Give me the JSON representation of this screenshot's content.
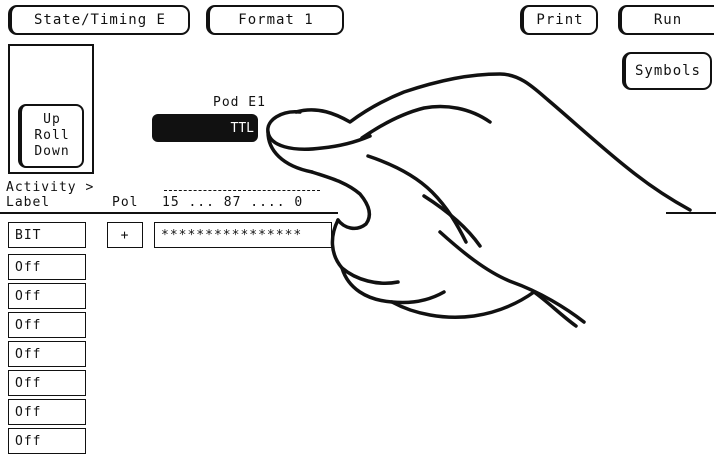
{
  "header": {
    "mode_button": "State/Timing E",
    "format_button": "Format 1",
    "print_button": "Print",
    "run_button": "Run",
    "symbols_button": "Symbols"
  },
  "roll": {
    "up": "Up",
    "roll": "Roll",
    "down": "Down"
  },
  "pod": {
    "title": "Pod E1",
    "threshold": "TTL"
  },
  "columns": {
    "activity": "Activity >",
    "label": "Label",
    "pol": "Pol",
    "bits": "15 ... 87 .... 0"
  },
  "rows": [
    {
      "label": "BIT",
      "pol": "+",
      "assignment": "****************"
    },
    {
      "label": "Off"
    },
    {
      "label": "Off"
    },
    {
      "label": "Off"
    },
    {
      "label": "Off"
    },
    {
      "label": "Off"
    },
    {
      "label": "Off"
    },
    {
      "label": "Off"
    }
  ]
}
